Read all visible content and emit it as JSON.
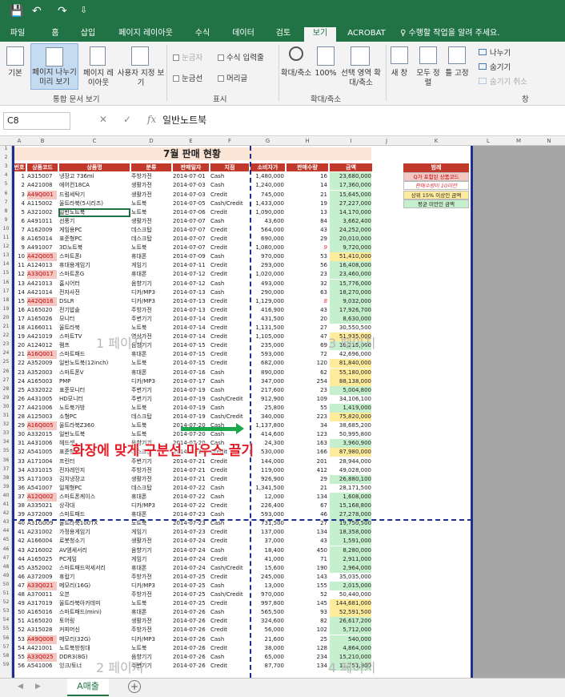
{
  "titlebar": {
    "save": "💾",
    "undo": "↶",
    "redo": "↷",
    "customize": "⇩"
  },
  "tabs": [
    "파일",
    "홈",
    "삽입",
    "페이지 레이아웃",
    "수식",
    "데이터",
    "검토",
    "보기",
    "ACROBAT"
  ],
  "active_tab": "보기",
  "tellme": "수행할 작업을 알려 주세요.",
  "ribbon": {
    "views": [
      "기본",
      "페이지 나누기 미리 보기",
      "페이지 레이아웃",
      "사용자 지정 보기"
    ],
    "group1": "통합 문서 보기",
    "show": {
      "ruler": "눈금자",
      "formula": "수식 입력줄",
      "gridlines": "눈금선",
      "headings": "머리글"
    },
    "group2": "표시",
    "zoom": [
      "확대/축소",
      "100%",
      "선택 영역 확대/축소"
    ],
    "group3": "확대/축소",
    "window": [
      "새 창",
      "모두 정렬",
      "틀 고정"
    ],
    "window_small": [
      "나누기",
      "숨기기",
      "숨기기 취소"
    ],
    "group4": "창"
  },
  "namebox": "C8",
  "fx": "fx",
  "formula": "일반노트북",
  "columns": [
    "A",
    "B",
    "C",
    "D",
    "E",
    "F",
    "G",
    "H",
    "I",
    "J",
    "K",
    "L",
    "M",
    "N"
  ],
  "sheet_title": "7월 판매 현황",
  "headers": [
    "번호",
    "상품코드",
    "상품명",
    "분류",
    "판매일자",
    "지점",
    "소비자가",
    "판매수량",
    "금액"
  ],
  "rows": [
    [
      "1",
      "A315007",
      "냉장고 736ml",
      "주방가전",
      "2014-07-01",
      "Cash",
      "1,480,000",
      "16",
      "23,680,000"
    ],
    [
      "2",
      "A421008",
      "에어컨18CA",
      "생활가전",
      "2014-07-03",
      "Cash",
      "1,240,000",
      "14",
      "17,360,000"
    ],
    [
      "3",
      "A49Q001",
      "드럼세탁기",
      "생활가전",
      "2014-07-03",
      "Credit",
      "745,000",
      "21",
      "15,645,000"
    ],
    [
      "4",
      "A115002",
      "울트라북(5시리즈)",
      "노트북",
      "2014-07-05",
      "Cash/Credit",
      "1,433,000",
      "19",
      "27,227,000"
    ],
    [
      "5",
      "A321002",
      "일반노트북",
      "노트북",
      "2014-07-06",
      "Credit",
      "1,090,000",
      "13",
      "14,170,000"
    ],
    [
      "6",
      "A491011",
      "선풍기",
      "생활가전",
      "2014-07-07",
      "Cash",
      "43,600",
      "84",
      "3,662,400"
    ],
    [
      "7",
      "A162009",
      "게임용PC",
      "데스크탑",
      "2014-07-07",
      "Credit",
      "564,000",
      "43",
      "24,252,000"
    ],
    [
      "8",
      "A165014",
      "표준형PC",
      "데스크탑",
      "2014-07-07",
      "Credit",
      "690,000",
      "29",
      "20,010,000"
    ],
    [
      "9",
      "A491007",
      "3D노트북",
      "노트북",
      "2014-07-07",
      "Credit",
      "1,080,000",
      "9",
      "9,720,000"
    ],
    [
      "10",
      "A42Q005",
      "스마트폰I",
      "휴대폰",
      "2014-07-09",
      "Cash",
      "970,000",
      "53",
      "51,410,000"
    ],
    [
      "11",
      "A124013",
      "휴대용게임기",
      "게임기",
      "2014-07-11",
      "Credit",
      "293,000",
      "56",
      "16,408,000"
    ],
    [
      "12",
      "A33Q017",
      "스마트폰G",
      "휴대폰",
      "2014-07-12",
      "Credit",
      "1,020,000",
      "23",
      "23,460,000"
    ],
    [
      "13",
      "A421013",
      "홈시어터",
      "음향기기",
      "2014-07-12",
      "Cash",
      "493,000",
      "32",
      "15,776,000"
    ],
    [
      "14",
      "A421014",
      "전자사전",
      "디카/MP3",
      "2014-07-13",
      "Cash",
      "290,000",
      "63",
      "18,270,000"
    ],
    [
      "15",
      "A42Q016",
      "DSLR",
      "디카/MP3",
      "2014-07-13",
      "Credit",
      "1,129,000",
      "8",
      "9,032,000"
    ],
    [
      "16",
      "A165020",
      "전기밥솥",
      "주방가전",
      "2014-07-13",
      "Credit",
      "416,900",
      "43",
      "17,926,700"
    ],
    [
      "17",
      "A165026",
      "모니터",
      "주변기기",
      "2014-07-14",
      "Credit",
      "431,500",
      "20",
      "8,630,000"
    ],
    [
      "18",
      "A166011",
      "울트라북",
      "노트북",
      "2014-07-14",
      "Credit",
      "1,131,500",
      "27",
      "30,550,500"
    ],
    [
      "19",
      "A421019",
      "스마트TV",
      "영상가전",
      "2014-07-14",
      "Credit",
      "1,105,000",
      "47",
      "51,935,000"
    ],
    [
      "20",
      "A124012",
      "램프",
      "음향기기",
      "2014-07-15",
      "Credit",
      "235,000",
      "69",
      "16,215,000"
    ],
    [
      "21",
      "A16Q001",
      "스마트패드",
      "휴대폰",
      "2014-07-15",
      "Credit",
      "593,000",
      "72",
      "42,696,000"
    ],
    [
      "22",
      "A352009",
      "일반노트북(12inch)",
      "노트북",
      "2014-07-15",
      "Credit",
      "682,000",
      "120",
      "81,840,000"
    ],
    [
      "23",
      "A352003",
      "스마트폰V",
      "휴대폰",
      "2014-07-16",
      "Cash",
      "890,000",
      "62",
      "55,180,000"
    ],
    [
      "24",
      "A165003",
      "PMP",
      "디카/MP3",
      "2014-07-17",
      "Cash",
      "347,000",
      "254",
      "88,138,000"
    ],
    [
      "25",
      "A332022",
      "표준모니터",
      "주변기기",
      "2014-07-19",
      "Cash",
      "217,600",
      "23",
      "5,004,800"
    ],
    [
      "26",
      "A431005",
      "HD모니터",
      "주변기기",
      "2014-07-19",
      "Cash/Credit",
      "912,900",
      "109",
      "34,106,100"
    ],
    [
      "27",
      "A421006",
      "노트북가방",
      "노트북",
      "2014-07-19",
      "Cash",
      "25,800",
      "55",
      "1,419,000"
    ],
    [
      "28",
      "A125003",
      "소형PC",
      "데스크탑",
      "2014-07-19",
      "Cash/Credit",
      "340,000",
      "223",
      "75,820,000"
    ],
    [
      "29",
      "A16Q005",
      "울트라북Z360",
      "노트북",
      "2014-07-20",
      "Cash",
      "1,137,800",
      "34",
      "38,685,200"
    ],
    [
      "30",
      "A332015",
      "일반노트북",
      "노트북",
      "2014-07-20",
      "Cash",
      "414,600",
      "123",
      "50,995,800"
    ],
    [
      "31",
      "A431006",
      "헤드셋",
      "음향기기",
      "2014-07-20",
      "Cash",
      "24,300",
      "163",
      "3,960,900"
    ],
    [
      "32",
      "A541005",
      "표준형PC",
      "데스크탑",
      "2014-07-20",
      "Credit",
      "530,000",
      "166",
      "87,980,000"
    ],
    [
      "33",
      "A171004",
      "프린터",
      "주변기기",
      "2014-07-21",
      "Credit",
      "144,000",
      "201",
      "28,944,000"
    ],
    [
      "34",
      "A331015",
      "전자레인지",
      "주방가전",
      "2014-07-21",
      "Credit",
      "119,000",
      "412",
      "49,028,000"
    ],
    [
      "35",
      "A171003",
      "김치냉장고",
      "생활가전",
      "2014-07-21",
      "Credit",
      "926,900",
      "29",
      "26,880,100"
    ],
    [
      "36",
      "A541007",
      "일체형PC",
      "데스크탑",
      "2014-07-22",
      "Cash",
      "1,341,500",
      "21",
      "28,171,500"
    ],
    [
      "37",
      "A12Q002",
      "스마트폰케이스",
      "휴대폰",
      "2014-07-22",
      "Cash",
      "12,000",
      "134",
      "1,608,000"
    ],
    [
      "38",
      "A335021",
      "상각대",
      "디카/MP3",
      "2014-07-22",
      "Credit",
      "226,400",
      "67",
      "15,168,800"
    ],
    [
      "39",
      "A372009",
      "스마트패드",
      "휴대폰",
      "2014-07-23",
      "Cash",
      "593,000",
      "46",
      "27,278,000"
    ],
    [
      "40",
      "A31G009",
      "울트라북100TX",
      "노트북",
      "2014-07-23",
      "Cash",
      "731,500",
      "27",
      "19,750,500"
    ],
    [
      "41",
      "A231002",
      "가정용게임기",
      "게임기",
      "2014-07-23",
      "Credit",
      "137,000",
      "134",
      "18,358,000"
    ],
    [
      "42",
      "A166004",
      "로봇청소기",
      "생활가전",
      "2014-07-24",
      "Credit",
      "37,000",
      "43",
      "1,591,000"
    ],
    [
      "43",
      "A216002",
      "AV엠세서리",
      "음향기기",
      "2014-07-24",
      "Cash",
      "18,400",
      "450",
      "8,280,000"
    ],
    [
      "44",
      "A165025",
      "PC게임",
      "게임기",
      "2014-07-24",
      "Credit",
      "41,000",
      "71",
      "2,911,000"
    ],
    [
      "45",
      "A352002",
      "스마트패드악세서리",
      "휴대폰",
      "2014-07-24",
      "Cash/Credit",
      "15,600",
      "190",
      "2,964,000"
    ],
    [
      "46",
      "A372009",
      "휴랍기",
      "주방가전",
      "2014-07-25",
      "Credit",
      "245,000",
      "143",
      "35,035,000"
    ],
    [
      "47",
      "A33Q021",
      "메모리(16G)",
      "디카/MP3",
      "2014-07-25",
      "Cash",
      "13,000",
      "155",
      "2,015,000"
    ],
    [
      "48",
      "A370011",
      "오븐",
      "주방가전",
      "2014-07-25",
      "Cash/Credit",
      "970,000",
      "52",
      "50,440,000"
    ],
    [
      "49",
      "A317019",
      "울트라북아카데미",
      "노트북",
      "2014-07-25",
      "Credit",
      "997,800",
      "145",
      "144,681,000"
    ],
    [
      "50",
      "A165016",
      "스마트패드(mini)",
      "휴대폰",
      "2014-07-26",
      "Cash",
      "565,500",
      "93",
      "52,591,500"
    ],
    [
      "51",
      "A165020",
      "토어링",
      "생활가전",
      "2014-07-26",
      "Credit",
      "324,600",
      "82",
      "26,617,200"
    ],
    [
      "52",
      "A315028",
      "커피머신",
      "주방가전",
      "2014-07-26",
      "Credit",
      "56,000",
      "102",
      "5,712,000"
    ],
    [
      "53",
      "A49Q008",
      "메모리(32G)",
      "디카/MP3",
      "2014-07-26",
      "Cash",
      "21,600",
      "25",
      "540,000"
    ],
    [
      "54",
      "A421001",
      "노트북방칭대",
      "노트북",
      "2014-07-26",
      "Credit",
      "38,000",
      "128",
      "4,864,000"
    ],
    [
      "55",
      "A33Q025",
      "DDR3(8G)",
      "음향기기",
      "2014-07-26",
      "Cash",
      "65,000",
      "234",
      "15,210,000"
    ],
    [
      "56",
      "A541006",
      "잉크/토너",
      "주변기기",
      "2014-07-26",
      "Credit",
      "87,700",
      "134",
      "11,751,800"
    ]
  ],
  "legend_title": "범례",
  "legend": [
    "Q가 포함된 상품코드",
    "판매수량이 10미만",
    "상위 15% 이상인 금액",
    "평균 미만인 금액"
  ],
  "page_labels": [
    "1 페이지",
    "3 페이지",
    "2 페이지",
    "4 페이지"
  ],
  "annotation": "화장에 맞게 구분선 마우스 끌기",
  "sheet_tab": "A매출",
  "colors": {
    "excel_green": "#217346",
    "header_red": "#c0392b",
    "page_break": "#1f2f8f",
    "green_fill": "#c6efce",
    "yellow_fill": "#ffeb9c",
    "red_text": "#e0303a",
    "arrow": "#1aa84a",
    "annotation": "#e31d25"
  }
}
